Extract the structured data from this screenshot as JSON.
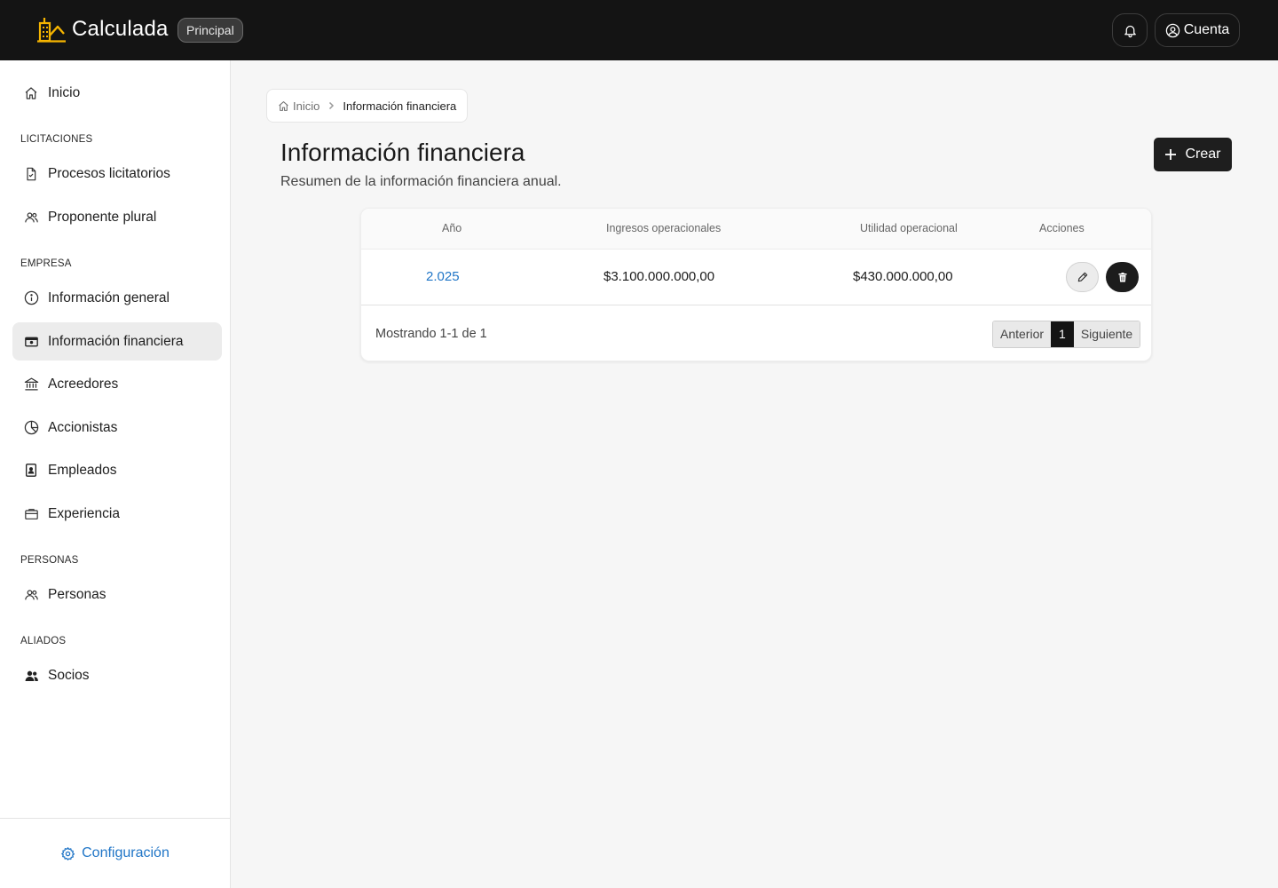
{
  "header": {
    "app_name": "Calculada",
    "env_badge": "Principal",
    "account_label": "Cuenta"
  },
  "sidebar": {
    "home": "Inicio",
    "sections": {
      "licitaciones": "LICITACIONES",
      "empresa": "EMPRESA",
      "personas": "PERSONAS",
      "aliados": "ALIADOS"
    },
    "items": {
      "procesos": "Procesos licitatorios",
      "proponente": "Proponente plural",
      "info_general": "Información general",
      "info_financiera": "Información financiera",
      "acreedores": "Acreedores",
      "accionistas": "Accionistas",
      "empleados": "Empleados",
      "experiencia": "Experiencia",
      "personas": "Personas",
      "socios": "Socios"
    },
    "active_item": "info_financiera",
    "footer_link": "Configuración"
  },
  "breadcrumb": {
    "home": "Inicio",
    "current": "Información financiera"
  },
  "page": {
    "title": "Información financiera",
    "subtitle": "Resumen de la información financiera anual.",
    "create_label": "Crear"
  },
  "table": {
    "columns": {
      "year": "Año",
      "income": "Ingresos operacionales",
      "profit": "Utilidad operacional",
      "actions": "Acciones"
    },
    "rows": [
      {
        "year": "2.025",
        "income": "$3.100.000.000,00",
        "profit": "$430.000.000,00"
      }
    ],
    "footer": {
      "showing": "Mostrando 1-1 de 1",
      "prev": "Anterior",
      "current_page": "1",
      "next": "Siguiente"
    }
  },
  "colors": {
    "topbar": "#141414",
    "accent_link": "#2176c7",
    "logo": "#f5b400",
    "primary_button": "#1e1e1e"
  },
  "icons": {
    "logo": "building-crane-icon",
    "bell": "bell-icon",
    "account": "user-circle-icon",
    "home": "home-icon",
    "procesos": "file-check-icon",
    "proponente": "users-icon",
    "info_general": "info-circle-icon",
    "info_financiera": "cash-icon",
    "acreedores": "bank-icon",
    "accionistas": "pie-chart-icon",
    "empleados": "id-badge-icon",
    "experiencia": "briefcase-icon",
    "personas": "users-icon",
    "socios": "users-filled-icon",
    "config": "gear-icon",
    "create": "plus-icon",
    "edit": "pencil-icon",
    "delete": "trash-icon"
  }
}
